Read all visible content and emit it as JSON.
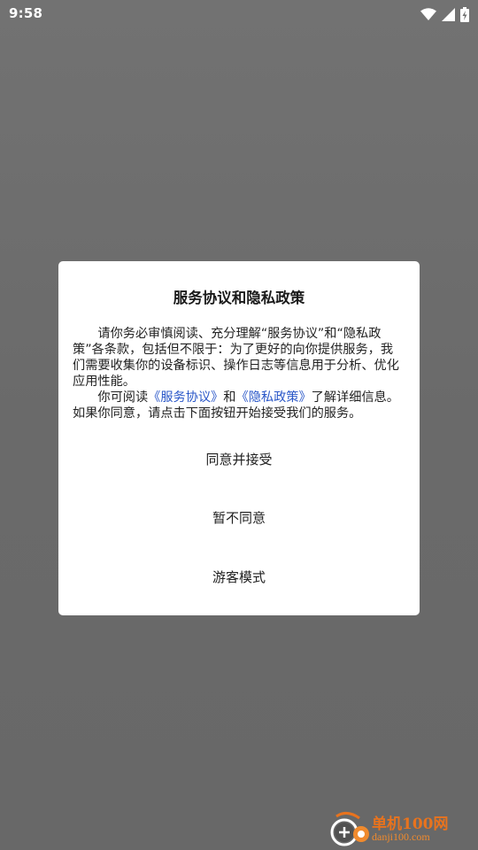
{
  "status_bar": {
    "time": "9:58",
    "icons": [
      "wifi-icon",
      "signal-icon",
      "battery-charging-icon"
    ]
  },
  "dialog": {
    "title": "服务协议和隐私政策",
    "paragraph1": "请你务必审慎阅读、充分理解“服务协议”和“隐私政策”各条款，包括但不限于：为了更好的向你提供服务，我们需要收集你的设备标识、操作日志等信息用于分析、优化应用性能。",
    "paragraph2": {
      "prefix": "你可阅读",
      "link_service": "《服务协议》",
      "middle": "和",
      "link_privacy": "《隐私政策》",
      "suffix": "了解详细信息。如果你同意，请点击下面按钮开始接受我们的服务。"
    },
    "actions": {
      "agree": "同意并接受",
      "decline": "暂不同意",
      "guest": "游客模式"
    }
  },
  "watermark": {
    "name": "单机100网",
    "url": "danji100.com"
  },
  "colors": {
    "link": "#2a57c8",
    "watermark": "#e8731e",
    "dialog_bg": "#ffffff",
    "scrim": "#6e6e6e"
  }
}
